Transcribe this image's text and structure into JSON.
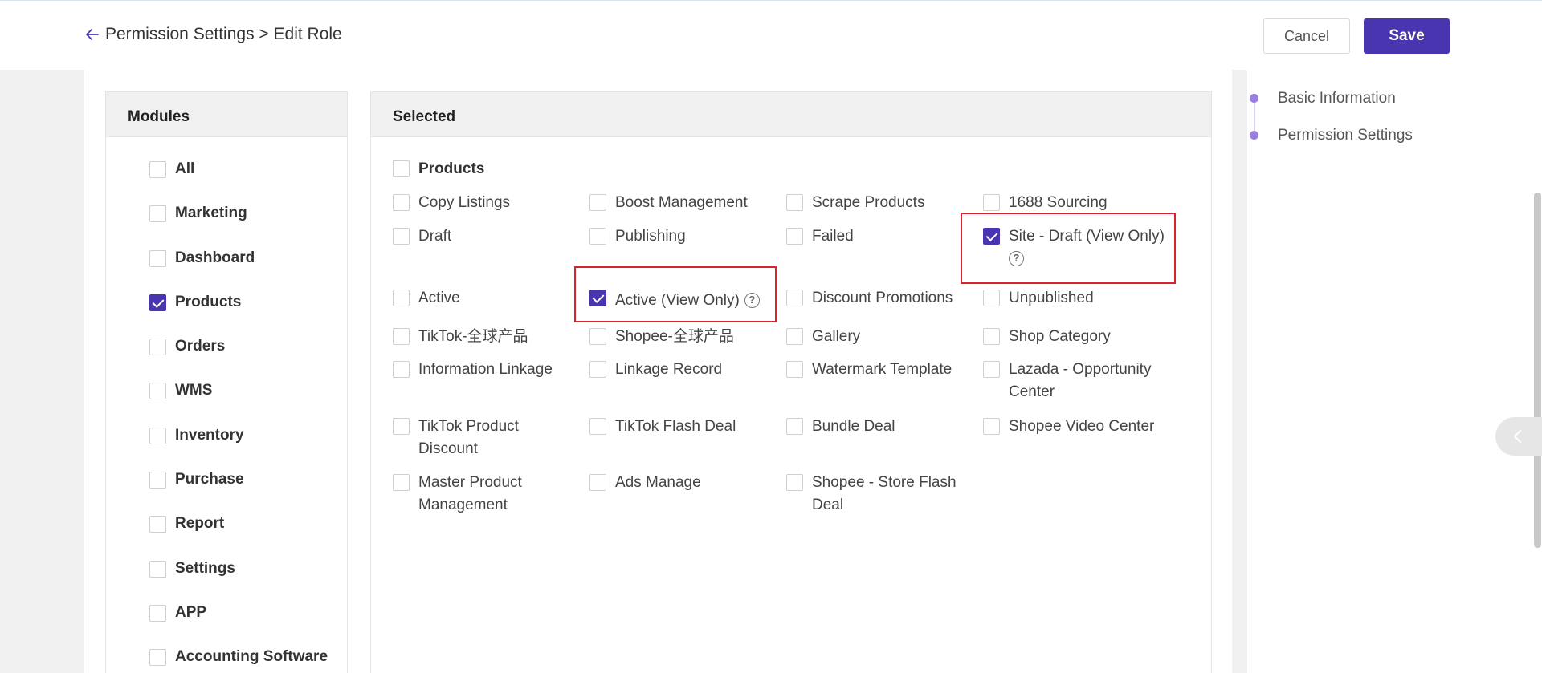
{
  "header": {
    "breadcrumb": "Permission Settings > Edit Role",
    "cancel_label": "Cancel",
    "save_label": "Save"
  },
  "modules": {
    "title": "Modules",
    "items": [
      {
        "label": "All",
        "checked": false
      },
      {
        "label": "Marketing",
        "checked": false
      },
      {
        "label": "Dashboard",
        "checked": false
      },
      {
        "label": "Products",
        "checked": true
      },
      {
        "label": "Orders",
        "checked": false
      },
      {
        "label": "WMS",
        "checked": false
      },
      {
        "label": "Inventory",
        "checked": false
      },
      {
        "label": "Purchase",
        "checked": false
      },
      {
        "label": "Report",
        "checked": false
      },
      {
        "label": "Settings",
        "checked": false
      },
      {
        "label": "APP",
        "checked": false
      },
      {
        "label": "Accounting Software",
        "checked": false
      }
    ]
  },
  "selected": {
    "title": "Selected",
    "group_label": "Products",
    "items": [
      {
        "label": "Copy Listings",
        "checked": false
      },
      {
        "label": "Boost Management",
        "checked": false
      },
      {
        "label": "Scrape Products",
        "checked": false
      },
      {
        "label": "1688 Sourcing",
        "checked": false
      },
      {
        "label": "Draft",
        "checked": false
      },
      {
        "label": "Publishing",
        "checked": false
      },
      {
        "label": "Failed",
        "checked": false
      },
      {
        "label": "Site - Draft (View Only)",
        "checked": true,
        "help": true
      },
      {
        "label": "Active",
        "checked": false
      },
      {
        "label": "Active (View Only)",
        "checked": true,
        "help": true
      },
      {
        "label": "Discount Promotions",
        "checked": false
      },
      {
        "label": "Unpublished",
        "checked": false
      },
      {
        "label": "TikTok-全球产品",
        "checked": false
      },
      {
        "label": "Shopee-全球产品",
        "checked": false
      },
      {
        "label": "Gallery",
        "checked": false
      },
      {
        "label": "Shop Category",
        "checked": false
      },
      {
        "label": "Information Linkage",
        "checked": false
      },
      {
        "label": "Linkage Record",
        "checked": false
      },
      {
        "label": "Watermark Template",
        "checked": false
      },
      {
        "label": "Lazada - Opportunity Center",
        "checked": false
      },
      {
        "label": "TikTok Product Discount",
        "checked": false
      },
      {
        "label": "TikTok Flash Deal",
        "checked": false
      },
      {
        "label": "Bundle Deal",
        "checked": false
      },
      {
        "label": "Shopee Video Center",
        "checked": false
      },
      {
        "label": "Master Product Management",
        "checked": false
      },
      {
        "label": "Ads Manage",
        "checked": false
      },
      {
        "label": "Shopee - Store Flash Deal",
        "checked": false
      }
    ]
  },
  "right_nav": {
    "items": [
      "Basic Information",
      "Permission Settings"
    ]
  },
  "colors": {
    "accent": "#4a35b0",
    "highlight_box": "#d9232d"
  }
}
